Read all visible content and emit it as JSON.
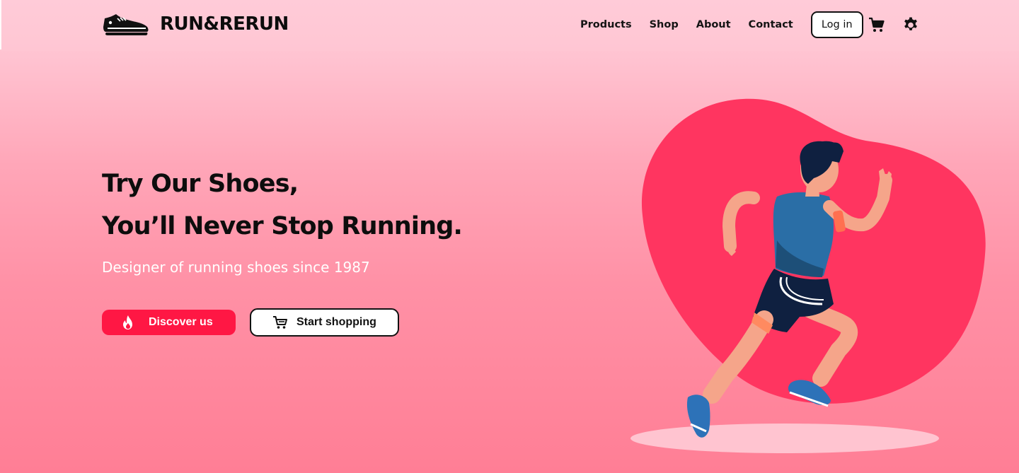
{
  "brand": {
    "name": "RUN&RERUN",
    "logo_icon": "shoe-icon"
  },
  "nav": {
    "links": [
      "Products",
      "Shop",
      "About",
      "Contact"
    ],
    "login_label": "Log in",
    "cart_icon": "cart-icon",
    "settings_icon": "gear-icon"
  },
  "hero": {
    "headline_line1": "Try Our Shoes,",
    "headline_line2": "You’ll Never Stop Running.",
    "subtitle": "Designer of running shoes since 1987",
    "primary_button": {
      "label": "Discover us",
      "icon": "flame-icon"
    },
    "secondary_button": {
      "label": "Start shopping",
      "icon": "cart-icon"
    }
  },
  "colors": {
    "accent": "#ff1744",
    "blob": "#ff3560",
    "background_top": "#ffc9d6",
    "background_bottom": "#ff7e95",
    "text_dark": "#111111"
  }
}
